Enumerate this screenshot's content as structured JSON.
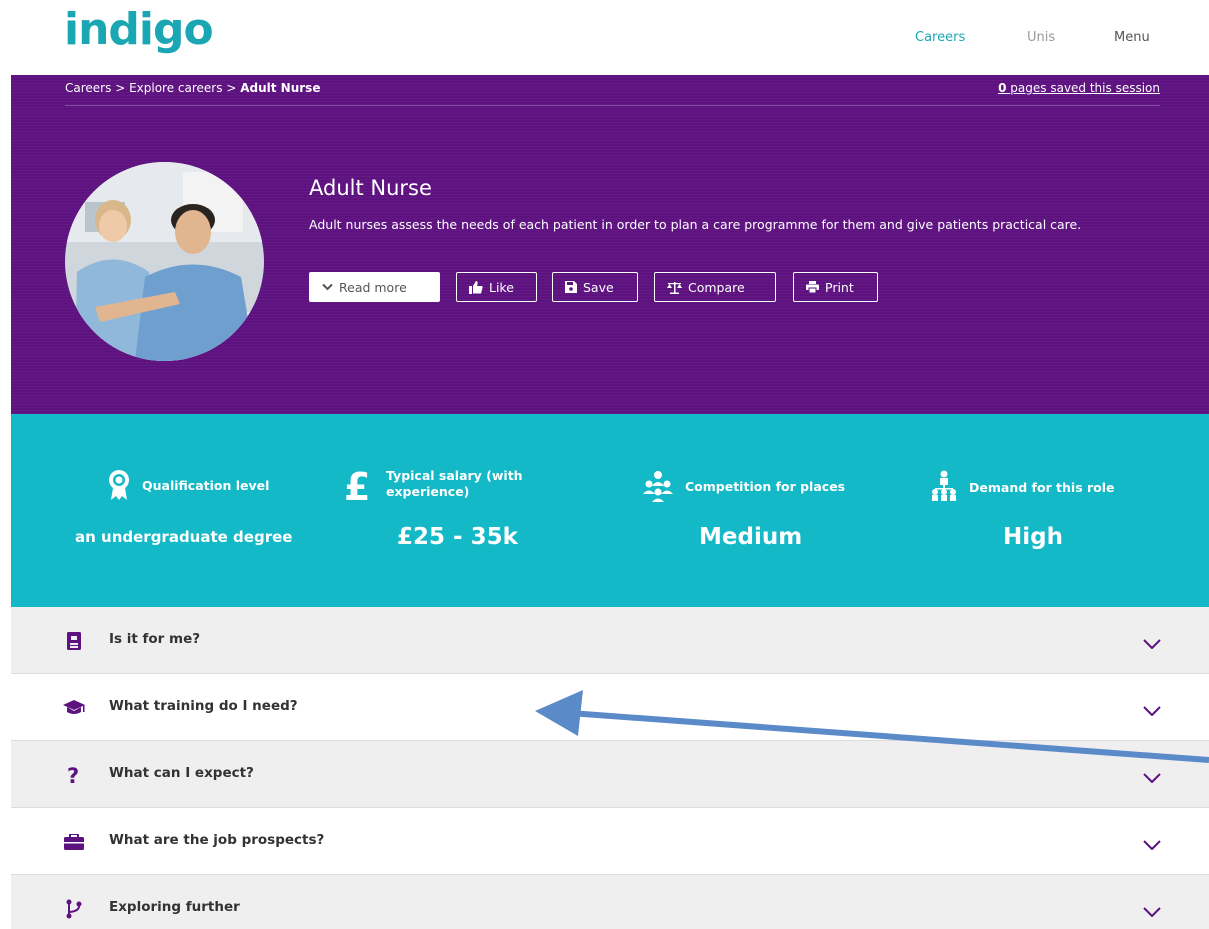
{
  "brand": {
    "logo_text": "indigo",
    "accent_color": "#1ba6b4",
    "purple": "#5d1280",
    "teal": "#14b9c7"
  },
  "top_nav": {
    "careers": "Careers",
    "unis": "Unis",
    "menu": "Menu"
  },
  "breadcrumb": {
    "items": [
      "Careers",
      "Explore careers"
    ],
    "separator": ">",
    "current": "Adult Nurse"
  },
  "saved_session": {
    "count": "0",
    "text": "pages saved this session"
  },
  "career": {
    "title": "Adult Nurse",
    "description": "Adult nurses assess the needs of each patient in order to plan a care programme for them and give patients practical care."
  },
  "actions": {
    "read_more": "Read more",
    "like": "Like",
    "save": "Save",
    "compare": "Compare",
    "print": "Print"
  },
  "stats": {
    "qualification": {
      "label": "Qualification level",
      "value": "an undergraduate degree",
      "icon": "award-icon"
    },
    "salary": {
      "label_line1": "Typical salary (with",
      "label_line2": "experience)",
      "value": "£25 - 35k",
      "icon": "pound-icon"
    },
    "competition": {
      "label": "Competition for places",
      "value": "Medium",
      "icon": "people-group-icon"
    },
    "demand": {
      "label": "Demand for this role",
      "value": "High",
      "icon": "org-chart-icon"
    }
  },
  "accordion": [
    {
      "label": "Is it for me?",
      "icon": "id-badge-icon"
    },
    {
      "label": "What training do I need?",
      "icon": "graduation-cap-icon"
    },
    {
      "label": "What can I expect?",
      "icon": "question-icon"
    },
    {
      "label": "What are the job prospects?",
      "icon": "briefcase-icon"
    },
    {
      "label": "Exploring further",
      "icon": "branch-icon"
    }
  ]
}
